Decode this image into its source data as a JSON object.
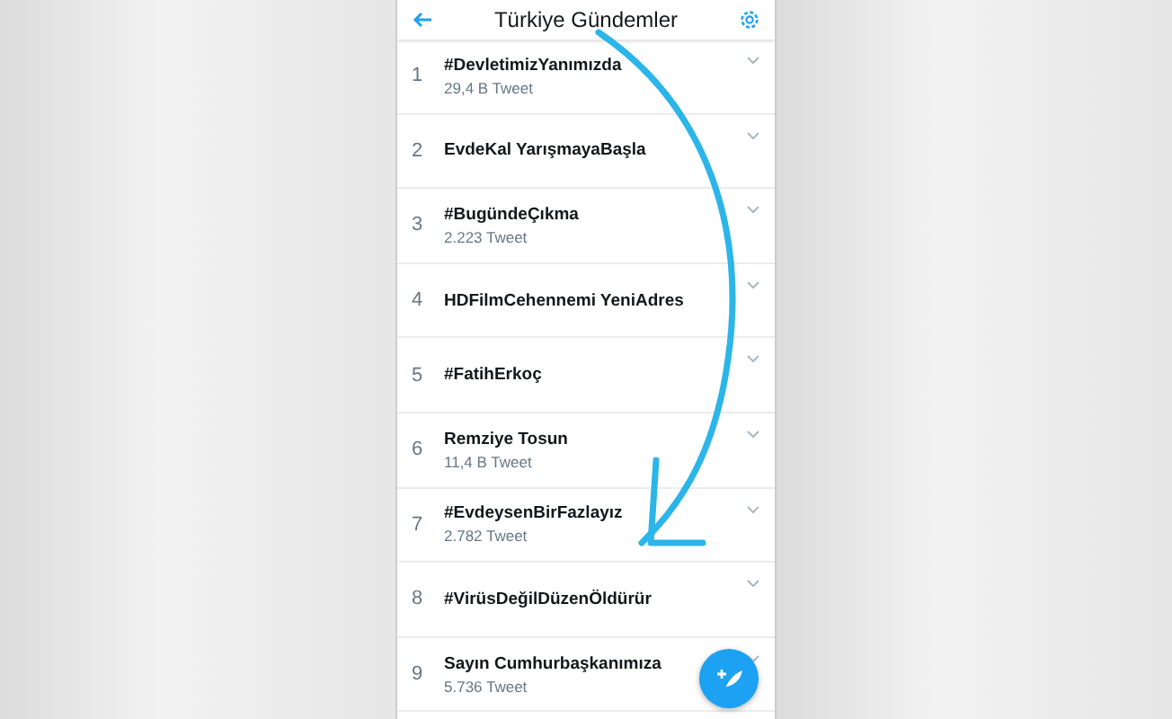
{
  "header": {
    "title": "Türkiye Gündemler"
  },
  "trends": [
    {
      "rank": "1",
      "name": "#DevletimizYanımızda",
      "count": "29,4 B Tweet"
    },
    {
      "rank": "2",
      "name": "EvdeKal YarışmayaBaşla"
    },
    {
      "rank": "3",
      "name": "#BugündeÇıkma",
      "count": "2.223 Tweet"
    },
    {
      "rank": "4",
      "name": "HDFilmCehennemi YeniAdres"
    },
    {
      "rank": "5",
      "name": "#FatihErkoç"
    },
    {
      "rank": "6",
      "name": "Remziye Tosun",
      "count": "11,4 B Tweet"
    },
    {
      "rank": "7",
      "name": "#EvdeysenBirFazlayız",
      "count": "2.782 Tweet"
    },
    {
      "rank": "8",
      "name": "#VirüsDeğilDüzenÖldürür"
    },
    {
      "rank": "9",
      "name": "Sayın Cumhurbaşkanımıza",
      "count": "5.736 Tweet"
    }
  ]
}
